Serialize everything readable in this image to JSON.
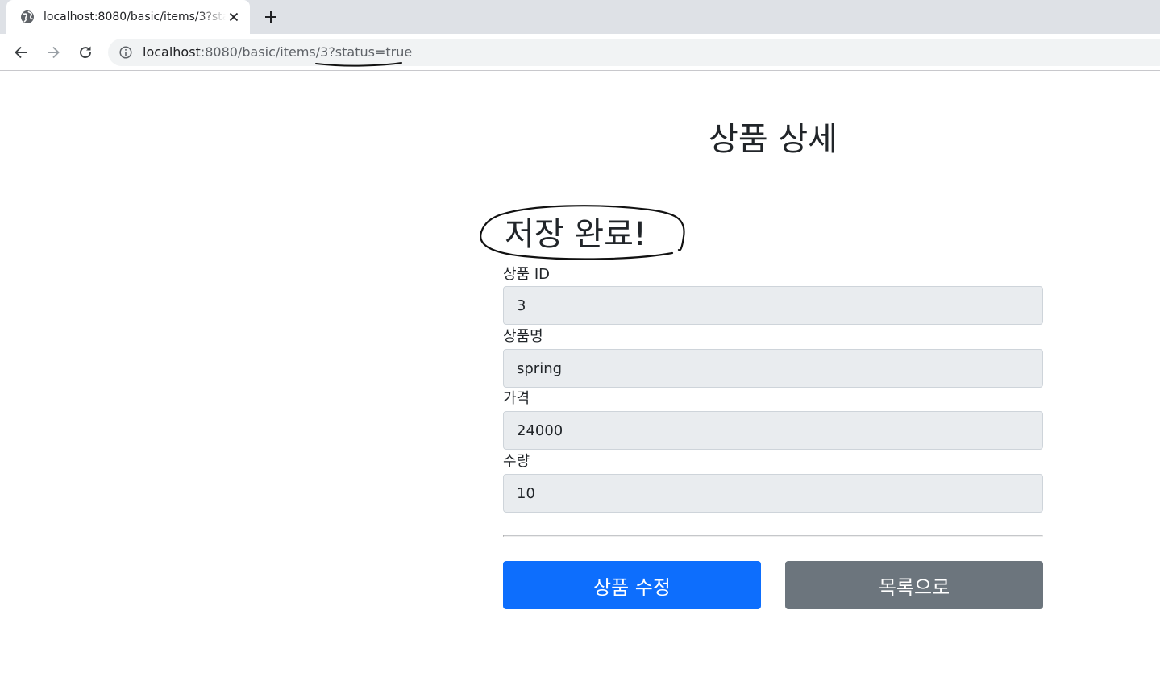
{
  "browser": {
    "tab": {
      "title": "localhost:8080/basic/items/3?status=true",
      "favicon": "globe-icon",
      "close": "close-icon"
    },
    "new_tab": "plus-icon",
    "nav": {
      "back": "back-arrow-icon",
      "forward": "forward-arrow-icon",
      "reload": "reload-icon"
    },
    "omnibox": {
      "icon": "info-icon",
      "url_host": "localhost",
      "url_rest": ":8080/basic/items/3?status=true"
    }
  },
  "page": {
    "title": "상품 상세",
    "status_message": "저장 완료!",
    "fields": [
      {
        "label": "상품 ID",
        "value": "3"
      },
      {
        "label": "상품명",
        "value": "spring"
      },
      {
        "label": "가격",
        "value": "24000"
      },
      {
        "label": "수량",
        "value": "10"
      }
    ],
    "buttons": {
      "edit": "상품 수정",
      "list": "목록으로"
    }
  },
  "colors": {
    "primary": "#0d6efd",
    "secondary": "#6c757d",
    "readonly_input_bg": "#e9ecef",
    "chrome_tabstrip": "#dee1e6",
    "omnibox_bg": "#f1f3f4"
  }
}
